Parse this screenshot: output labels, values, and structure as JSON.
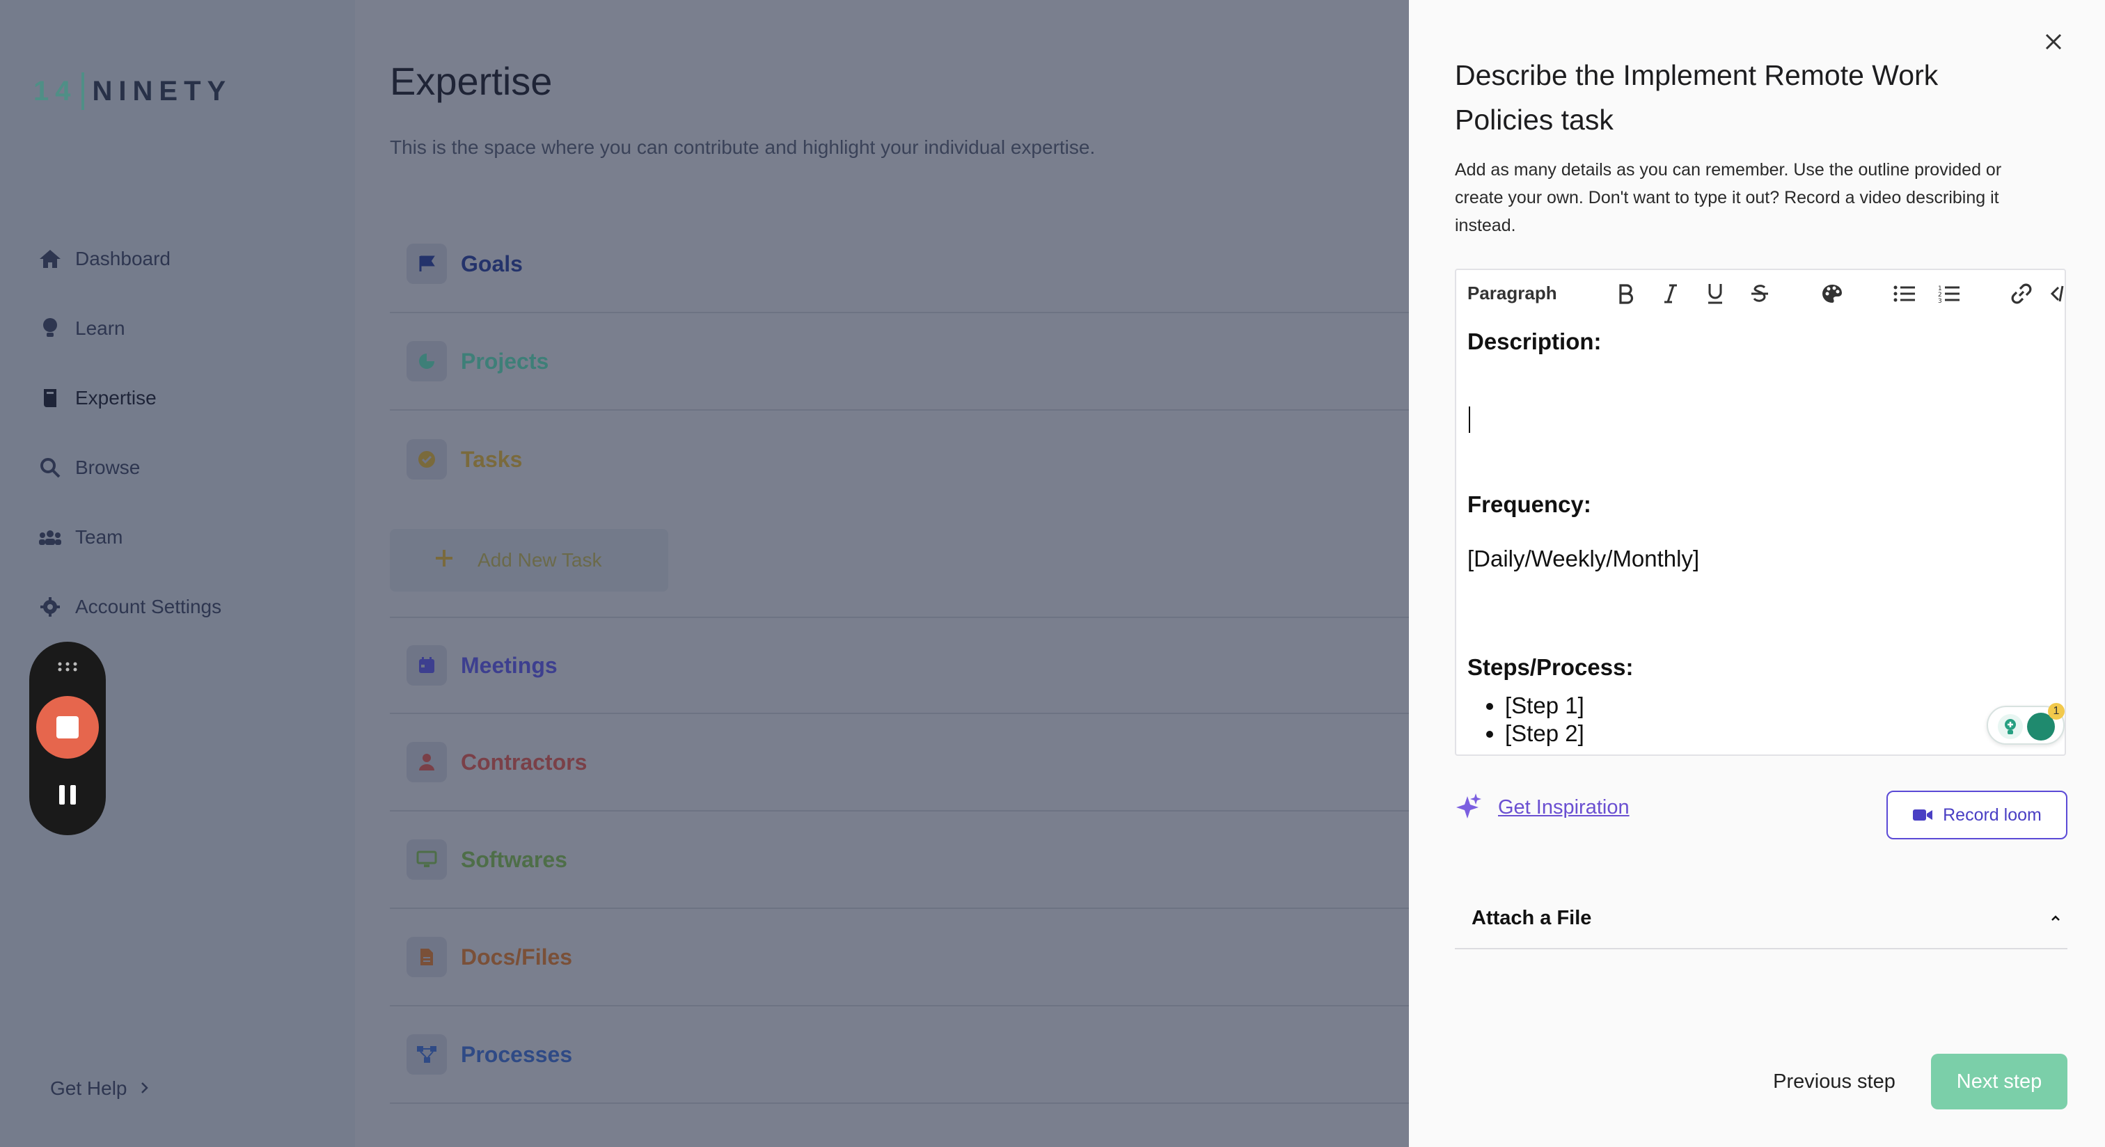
{
  "sidebar": {
    "logo": {
      "num": "14",
      "word": "NINETY"
    },
    "items": [
      {
        "label": "Dashboard",
        "icon": "home-icon"
      },
      {
        "label": "Learn",
        "icon": "lightbulb-icon"
      },
      {
        "label": "Expertise",
        "icon": "book-icon",
        "active": true
      },
      {
        "label": "Browse",
        "icon": "search-icon"
      },
      {
        "label": "Team",
        "icon": "team-icon"
      },
      {
        "label": "Account Settings",
        "icon": "gear-icon"
      }
    ],
    "get_help": "Get Help"
  },
  "main": {
    "title": "Expertise",
    "subtitle": "This is the space where you can contribute and highlight your individual expertise.",
    "sections": [
      {
        "label": "Goals",
        "color": "#24336b",
        "icon": "flag-icon"
      },
      {
        "label": "Projects",
        "color": "#3e7f78",
        "icon": "pie-chart-icon"
      },
      {
        "label": "Tasks",
        "color": "#7a6a3c",
        "icon": "check-circle-icon"
      },
      {
        "label": "Meetings",
        "color": "#3d3f8f",
        "icon": "calendar-icon"
      },
      {
        "label": "Contractors",
        "color": "#7a4048",
        "icon": "user-icon"
      },
      {
        "label": "Softwares",
        "color": "#4e6e48",
        "icon": "monitor-icon"
      },
      {
        "label": "Docs/Files",
        "color": "#7a5038",
        "icon": "document-icon"
      },
      {
        "label": "Processes",
        "color": "#2f4a85",
        "icon": "flow-icon"
      }
    ],
    "add_task": "Add New Task"
  },
  "drawer": {
    "title": "Describe the Implement Remote Work Policies task",
    "description": "Add as many details as you can remember. Use the outline provided or create your own. Don't want to type it out? Record a video describing it instead.",
    "toolbar": {
      "paragraph": "Paragraph"
    },
    "editor": {
      "description_heading": "Description:",
      "frequency_heading": "Frequency:",
      "frequency_value": "[Daily/Weekly/Monthly]",
      "steps_heading": "Steps/Process:",
      "steps": [
        "[Step 1]",
        "[Step 2]"
      ],
      "grammar_badge": "1"
    },
    "inspiration": "Get Inspiration",
    "record_loom": "Record loom",
    "attach_file": "Attach a File",
    "previous_step": "Previous step",
    "next_step": "Next step",
    "colors": {
      "accent": "#5b4ad6",
      "next_button": "#7bcfa9"
    }
  }
}
